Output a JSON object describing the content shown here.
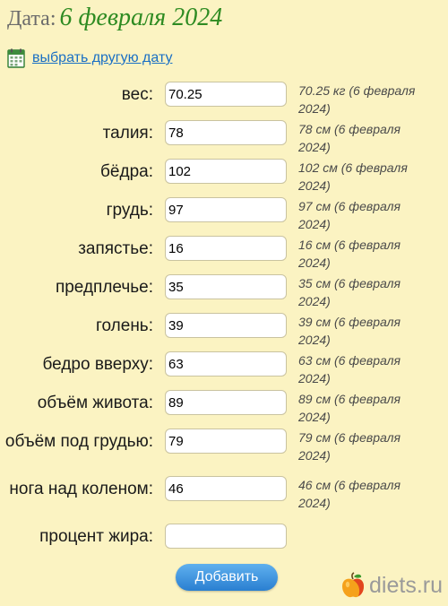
{
  "header": {
    "date_label": "Дата:",
    "date_value": "6 февраля 2024"
  },
  "pick_date": {
    "icon": "calendar-icon",
    "link": "выбрать другую дату"
  },
  "fields": [
    {
      "label": "вес:",
      "value": "70.25",
      "note": "70.25 кг (6 февраля 2024)"
    },
    {
      "label": "талия:",
      "value": "78",
      "note": "78 см (6 февраля 2024)"
    },
    {
      "label": "бёдра:",
      "value": "102",
      "note": "102 см (6 февраля 2024)"
    },
    {
      "label": "грудь:",
      "value": "97",
      "note": "97 см (6 февраля 2024)"
    },
    {
      "label": "запястье:",
      "value": "16",
      "note": "16 см (6 февраля 2024)"
    },
    {
      "label": "предплечье:",
      "value": "35",
      "note": "35 см (6 февраля 2024)"
    },
    {
      "label": "голень:",
      "value": "39",
      "note": "39 см (6 февраля 2024)"
    },
    {
      "label": "бедро вверху:",
      "value": "63",
      "note": "63 см (6 февраля 2024)"
    },
    {
      "label": "объём живота:",
      "value": "89",
      "note": "89 см (6 февраля 2024)"
    },
    {
      "label": "объём под грудью:",
      "value": "79",
      "note": "79 см (6 февраля 2024)"
    },
    {
      "label": "нога над коленом:",
      "value": "46",
      "note": "46 см (6 февраля 2024)"
    },
    {
      "label": "процент жира:",
      "value": "",
      "note": ""
    }
  ],
  "add_button": "Добавить",
  "logo": {
    "text": "diets.ru",
    "icon": "apple-icon"
  },
  "colors": {
    "background": "#fbf3c2",
    "date_value": "#2e8b22",
    "link": "#1a6fc4",
    "button": "#2a7fd1"
  }
}
